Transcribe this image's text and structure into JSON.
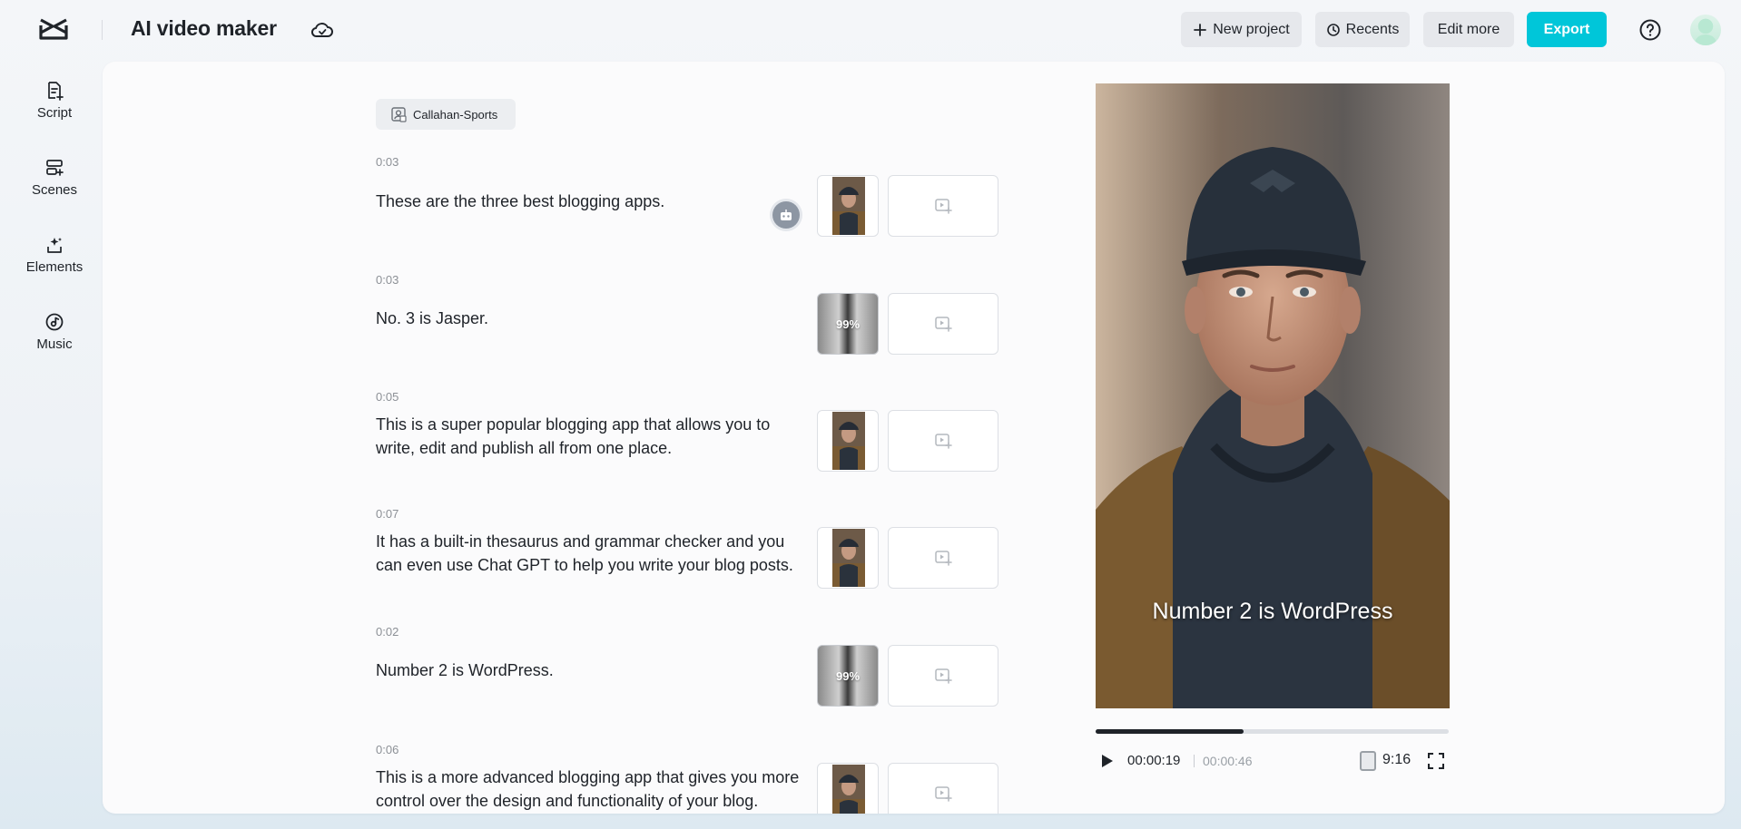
{
  "header": {
    "app_title": "AI video maker",
    "buttons": {
      "new_project": "New project",
      "recents": "Recents",
      "edit_more": "Edit more",
      "export": "Export"
    },
    "accent_color": "#00c6d9"
  },
  "sidebar": {
    "items": [
      {
        "label": "Script",
        "icon": "script-icon"
      },
      {
        "label": "Scenes",
        "icon": "scenes-icon"
      },
      {
        "label": "Elements",
        "icon": "elements-icon"
      },
      {
        "label": "Music",
        "icon": "music-icon"
      }
    ]
  },
  "script": {
    "avatar_name": "Callahan-Sports",
    "scenes": [
      {
        "duration": "0:03",
        "text": "These are the three best blogging apps.",
        "thumb": "image"
      },
      {
        "duration": "0:03",
        "text": "No. 3 is Jasper.",
        "thumb": "loading",
        "progress": "99%"
      },
      {
        "duration": "0:05",
        "text": "This is a super popular blogging app that allows you to write, edit and publish all from one place.",
        "thumb": "image"
      },
      {
        "duration": "0:07",
        "text": "It has a built-in thesaurus and grammar checker and you can even use Chat GPT to help you write your blog posts.",
        "thumb": "image"
      },
      {
        "duration": "0:02",
        "text": "Number 2 is WordPress.",
        "thumb": "loading",
        "progress": "99%"
      },
      {
        "duration": "0:06",
        "text": "This is a more advanced blogging app that gives you more control over the design and functionality of your blog.",
        "thumb": "image"
      }
    ]
  },
  "preview": {
    "caption": "Number 2 is WordPress",
    "current_time": "00:00:19",
    "total_time": "00:00:46",
    "progress_fraction": 0.42,
    "aspect_ratio": "9:16"
  }
}
